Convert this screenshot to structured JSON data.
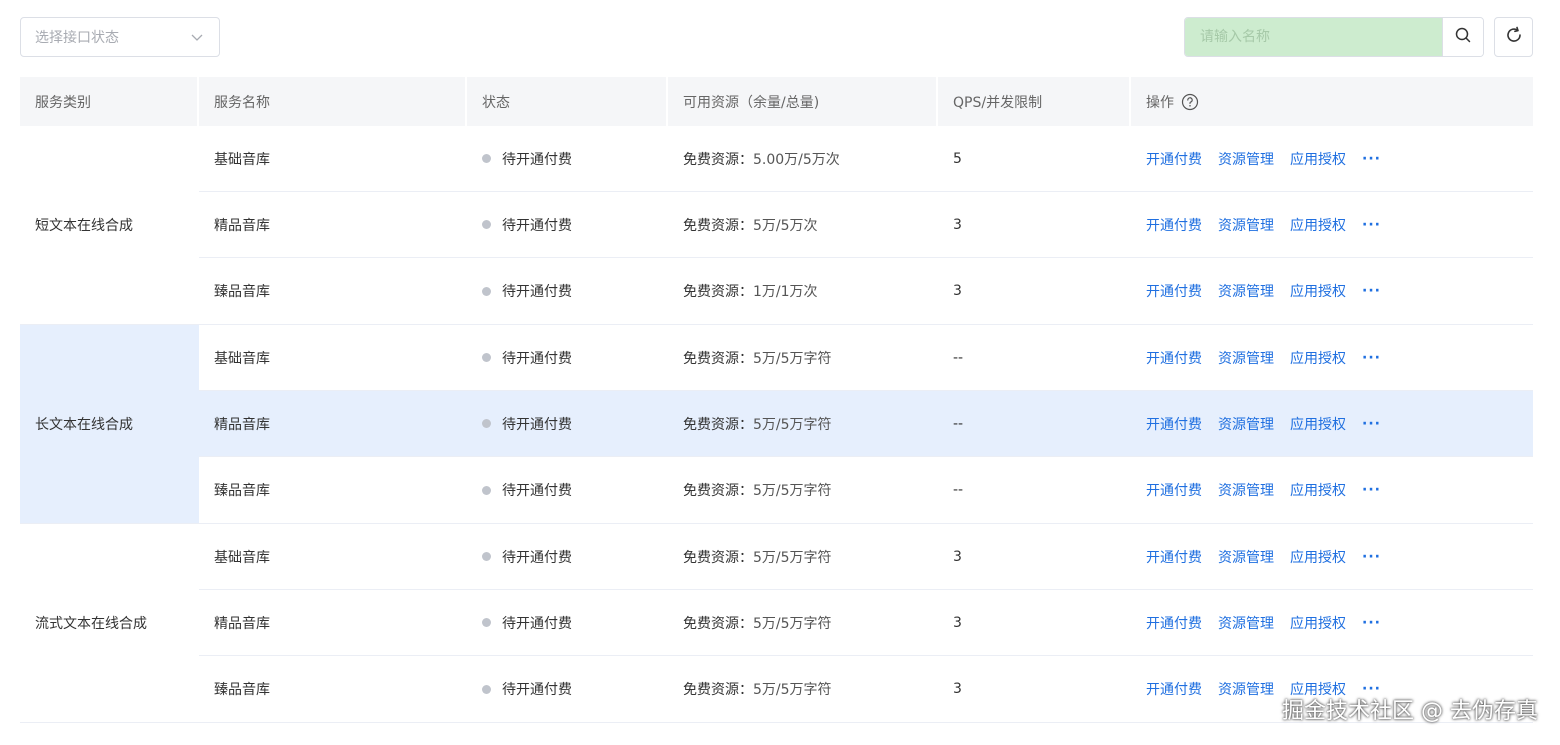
{
  "toolbar": {
    "status_select_placeholder": "选择接口状态",
    "search_placeholder": "请输入名称"
  },
  "table": {
    "headers": [
      "服务类别",
      "服务名称",
      "状态",
      "可用资源（余量/总量)",
      "QPS/并发限制",
      "操作"
    ],
    "groups": [
      {
        "category": "短文本在线合成",
        "rows": [
          {
            "name": "基础音库",
            "status": "待开通付费",
            "res_label": "免费资源：",
            "res_value": "5.00万/5万次",
            "qps": "5"
          },
          {
            "name": "精品音库",
            "status": "待开通付费",
            "res_label": "免费资源：",
            "res_value": "5万/5万次",
            "qps": "3"
          },
          {
            "name": "臻品音库",
            "status": "待开通付费",
            "res_label": "免费资源：",
            "res_value": "1万/1万次",
            "qps": "3"
          }
        ]
      },
      {
        "category": "长文本在线合成",
        "rows": [
          {
            "name": "基础音库",
            "status": "待开通付费",
            "res_label": "免费资源：",
            "res_value": "5万/5万字符",
            "qps": "--"
          },
          {
            "name": "精品音库",
            "status": "待开通付费",
            "res_label": "免费资源：",
            "res_value": "5万/5万字符",
            "qps": "--"
          },
          {
            "name": "臻品音库",
            "status": "待开通付费",
            "res_label": "免费资源：",
            "res_value": "5万/5万字符",
            "qps": "--"
          }
        ]
      },
      {
        "category": "流式文本在线合成",
        "rows": [
          {
            "name": "基础音库",
            "status": "待开通付费",
            "res_label": "免费资源：",
            "res_value": "5万/5万字符",
            "qps": "3"
          },
          {
            "name": "精品音库",
            "status": "待开通付费",
            "res_label": "免费资源：",
            "res_value": "5万/5万字符",
            "qps": "3"
          },
          {
            "name": "臻品音库",
            "status": "待开通付费",
            "res_label": "免费资源：",
            "res_value": "5万/5万字符",
            "qps": "3"
          }
        ]
      }
    ],
    "actions": {
      "open_pay": "开通付费",
      "resource_manage": "资源管理",
      "app_auth": "应用授权",
      "more": "···"
    }
  },
  "colors": {
    "link": "#1f6fe0",
    "highlight_row": "#e6effd",
    "search_bg": "#cdeccf",
    "status_dot": "#c0c4cc"
  },
  "watermark": "掘金技术社区 @ 去伪存真"
}
